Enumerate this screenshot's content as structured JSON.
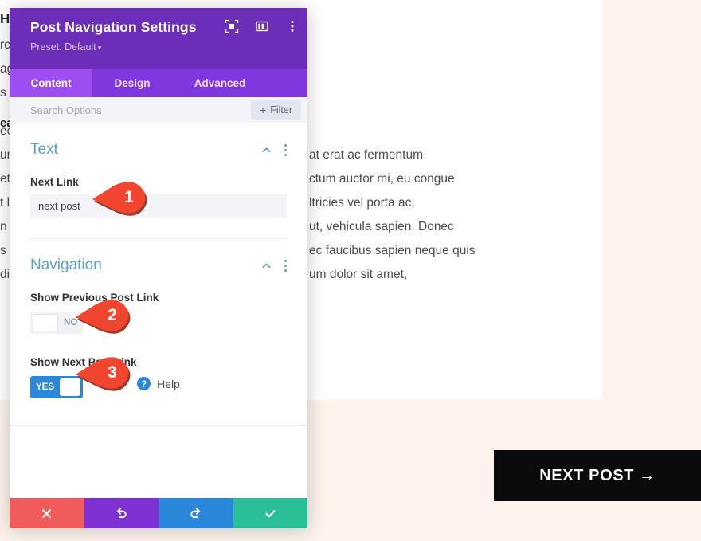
{
  "background": {
    "heading_fragment": "He",
    "top_line_fragments": [
      "rc",
      "ag",
      "s"
    ],
    "subheading_fragment": "ea",
    "left_fragments": [
      "ec",
      "un",
      "et",
      "t l",
      "n e",
      "s s",
      "di"
    ],
    "paragraph_lines": [
      "at erat ac fermentum",
      "ctum auctor mi, eu congue",
      "ltricies vel porta ac,",
      "ut, vehicula sapien. Donec",
      "ec faucibus sapien neque quis",
      "um dolor sit amet,"
    ],
    "next_post_button": "NEXT POST →",
    "page_bg_color": "#fdf3ec",
    "card_bg_color": "#ffffff",
    "button_bg_color": "#0b0b0b"
  },
  "modal": {
    "title": "Post Navigation Settings",
    "preset_label": "Preset: Default",
    "preset_caret": "▾",
    "header_icons": [
      "focus-icon",
      "layout-columns-icon",
      "more-vertical-icon"
    ],
    "header_color": "#6c2eb9",
    "tabs": [
      {
        "label": "Content",
        "active": true
      },
      {
        "label": "Design",
        "active": false
      },
      {
        "label": "Advanced",
        "active": false
      }
    ],
    "search": {
      "value": "",
      "placeholder": "Search Options"
    },
    "filter_button": {
      "icon": "plus-icon",
      "label": "Filter"
    },
    "sections": [
      {
        "title": "Text",
        "collapse_icon": "chevron-up-icon",
        "menu_icon": "more-vertical-icon",
        "fields": [
          {
            "label": "Next Link",
            "type": "text",
            "value": "next post"
          }
        ]
      },
      {
        "title": "Navigation",
        "collapse_icon": "chevron-up-icon",
        "menu_icon": "more-vertical-icon",
        "fields": [
          {
            "label": "Show Previous Post Link",
            "type": "toggle",
            "value": "NO",
            "state": "off"
          },
          {
            "label": "Show Next Post Link",
            "type": "toggle",
            "value": "YES",
            "state": "on"
          }
        ]
      }
    ],
    "help": {
      "icon": "question-circle-icon",
      "label": "Help"
    },
    "footer_buttons": [
      {
        "name": "cancel",
        "icon": "close-icon",
        "color": "#f05b5b"
      },
      {
        "name": "undo",
        "icon": "undo-icon",
        "color": "#8031d4"
      },
      {
        "name": "redo",
        "icon": "redo-icon",
        "color": "#2b87da"
      },
      {
        "name": "save",
        "icon": "check-icon",
        "color": "#2bbf97"
      }
    ]
  },
  "callouts": [
    {
      "number": "1",
      "color": "#f0462f"
    },
    {
      "number": "2",
      "color": "#f0462f"
    },
    {
      "number": "3",
      "color": "#f0462f"
    }
  ]
}
